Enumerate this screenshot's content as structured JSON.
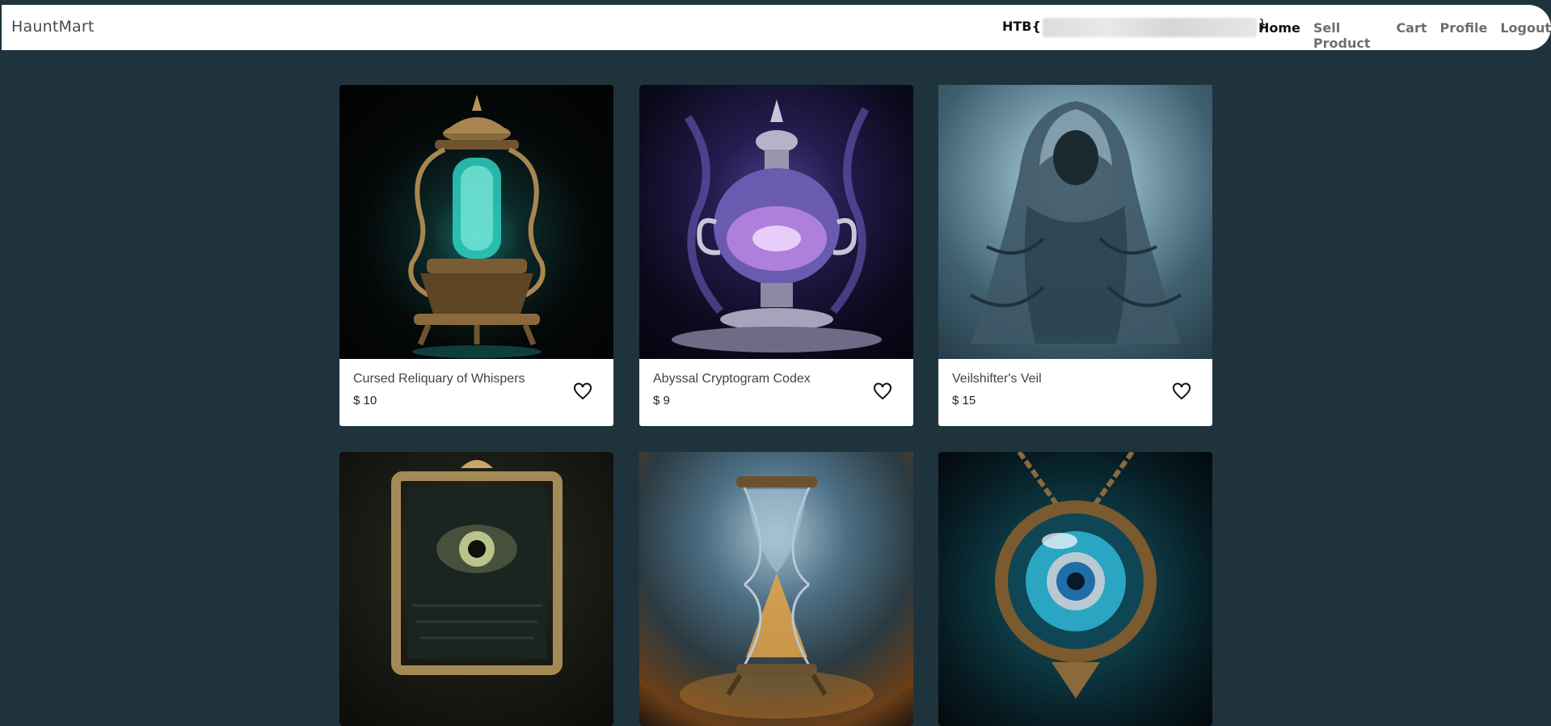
{
  "navbar": {
    "brand": "HauntMart",
    "flag_prefix": "HTB{",
    "flag_suffix": "}",
    "links": [
      {
        "label": "Home",
        "active": true
      },
      {
        "label": "Sell Product",
        "active": false
      },
      {
        "label": "Cart",
        "active": false
      },
      {
        "label": "Profile",
        "active": false
      },
      {
        "label": "Logout",
        "active": false
      }
    ]
  },
  "products": [
    {
      "name": "Cursed Reliquary of Whispers",
      "price": "$ 10",
      "image": "ornate-lantern"
    },
    {
      "name": "Abyssal Cryptogram Codex",
      "price": "$ 9",
      "image": "purple-urn"
    },
    {
      "name": "Veilshifter's Veil",
      "price": "$ 15",
      "image": "hooded-ghost"
    },
    {
      "name": "",
      "price": "",
      "image": "eye-mirror"
    },
    {
      "name": "",
      "price": "",
      "image": "hourglass"
    },
    {
      "name": "",
      "price": "",
      "image": "eye-amulet"
    }
  ],
  "colors": {
    "background": "#1f333d",
    "navbar": "#ffffff",
    "card": "#ffffff"
  }
}
